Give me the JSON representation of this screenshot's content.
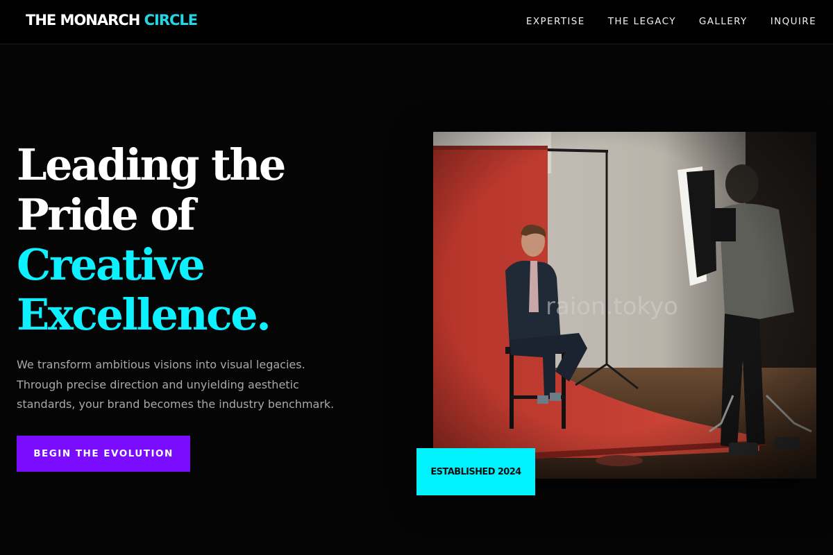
{
  "brand": {
    "name_main": "THE MONARCH",
    "name_accent": "CIRCLE"
  },
  "nav": {
    "items": [
      {
        "label": "EXPERTISE"
      },
      {
        "label": "THE LEGACY"
      },
      {
        "label": "GALLERY"
      },
      {
        "label": "INQUIRE"
      }
    ]
  },
  "hero": {
    "title_lines": [
      {
        "text": "Leading the",
        "style": "white"
      },
      {
        "text": "Pride of",
        "style": "white"
      },
      {
        "text": "Creative",
        "style": "cyan"
      },
      {
        "text": "Excellence.",
        "style": "cyan"
      }
    ],
    "subtitle_lines": [
      "We transform ambitious visions into visual legacies.",
      "Through precise direction and unyielding aesthetic",
      "standards, your brand becomes the industry benchmark."
    ],
    "cta_label": "BEGIN THE EVOLUTION"
  },
  "image": {
    "description_icon": "photo-studio-shoot",
    "watermark": "raion.tokyo"
  },
  "badge": {
    "label": "ESTABLISHED 2024"
  },
  "colors": {
    "background": "#050505",
    "accent_cyan": "#0df0ff",
    "accent_purple": "#7a0cff",
    "brand_accent": "#22d8e6"
  }
}
